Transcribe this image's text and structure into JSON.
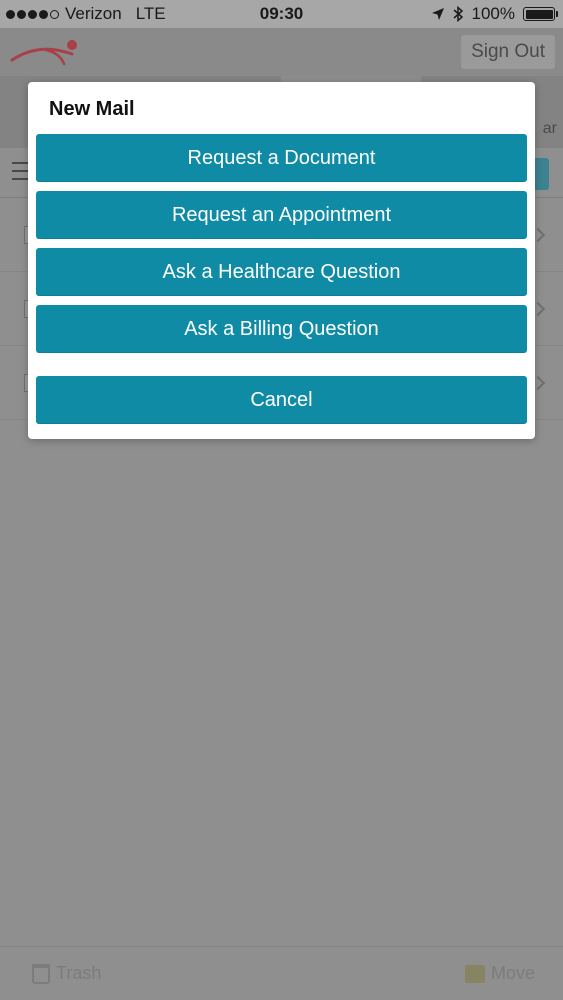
{
  "status_bar": {
    "carrier": "Verizon",
    "network": "LTE",
    "time": "09:30",
    "battery": "100%"
  },
  "header": {
    "signout_label": "Sign Out"
  },
  "tabs": {
    "partial_label": "ar"
  },
  "bottom_bar": {
    "trash_label": "Trash",
    "move_label": "Move"
  },
  "modal": {
    "title": "New Mail",
    "options": [
      "Request a Document",
      "Request an Appointment",
      "Ask a Healthcare Question",
      "Ask a Billing Question"
    ],
    "cancel_label": "Cancel"
  },
  "colors": {
    "button": "#0f8ba6",
    "overlay": "#8f8f8f",
    "logo_accent": "#b1363f"
  }
}
